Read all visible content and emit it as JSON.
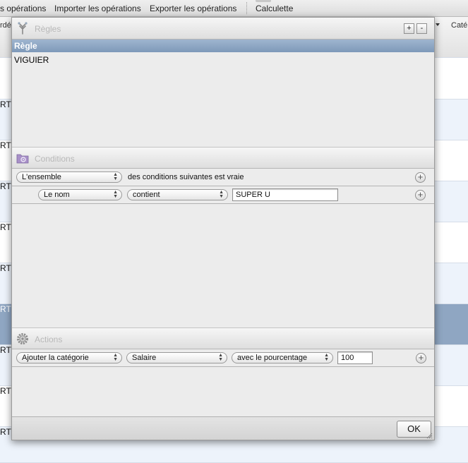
{
  "toolbar": {
    "items": [
      "s opérations",
      "Importer les opérations",
      "Exporter les opérations",
      "Calculette"
    ]
  },
  "background_table": {
    "header_left": "rdé",
    "header_right": "Caté",
    "row_cell_text": "RTE"
  },
  "panel": {
    "rules": {
      "title": "Règles",
      "add_label": "+",
      "remove_label": "-",
      "list_header": "Règle",
      "items": [
        "VIGUIER"
      ]
    },
    "conditions": {
      "title": "Conditions",
      "match_popup": "L'ensemble",
      "match_suffix": "des conditions suivantes est vraie",
      "rows": [
        {
          "field": "Le nom",
          "operator": "contient",
          "value": "SUPER U"
        }
      ]
    },
    "actions": {
      "title": "Actions",
      "rows": [
        {
          "action": "Ajouter la catégorie",
          "category": "Salaire",
          "mode": "avec le pourcentage",
          "value": "100"
        }
      ]
    },
    "ok_label": "OK"
  },
  "colors": {
    "selection_header": "#8fa6c2",
    "section_title": "#b8b8b8",
    "panel_bg": "#ececec"
  }
}
